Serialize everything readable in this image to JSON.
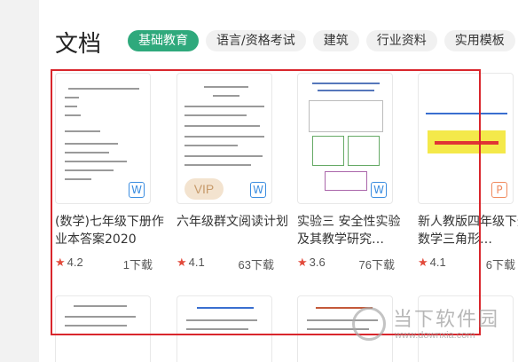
{
  "section": {
    "title": "文档"
  },
  "tabs": [
    {
      "label": "基础教育",
      "active": true
    },
    {
      "label": "语言/资格考试",
      "active": false
    },
    {
      "label": "建筑",
      "active": false
    },
    {
      "label": "行业资料",
      "active": false
    },
    {
      "label": "实用模板",
      "active": false
    }
  ],
  "cards": [
    {
      "title": "(数学)七年级下册作业本答案2020",
      "rating": "4.2",
      "downloads": "1下载",
      "file_type": "W",
      "vip": ""
    },
    {
      "title": "六年级群文阅读计划",
      "rating": "4.1",
      "downloads": "63下载",
      "file_type": "W",
      "vip": "VIP"
    },
    {
      "title": "实验三 安全性实验及其教学研究…",
      "rating": "3.6",
      "downloads": "76下载",
      "file_type": "W",
      "vip": ""
    },
    {
      "title": "新人教版四年级下册数学三角形…",
      "rating": "4.1",
      "downloads": "6下载",
      "file_type": "P",
      "vip": ""
    }
  ],
  "icons": {
    "star": "★"
  },
  "watermark": {
    "text": "当下软件园",
    "sub": "www.downxia.com"
  },
  "colors": {
    "accent": "#2fa97c",
    "highlight_box": "#d9262c",
    "star": "#e24a3b"
  }
}
